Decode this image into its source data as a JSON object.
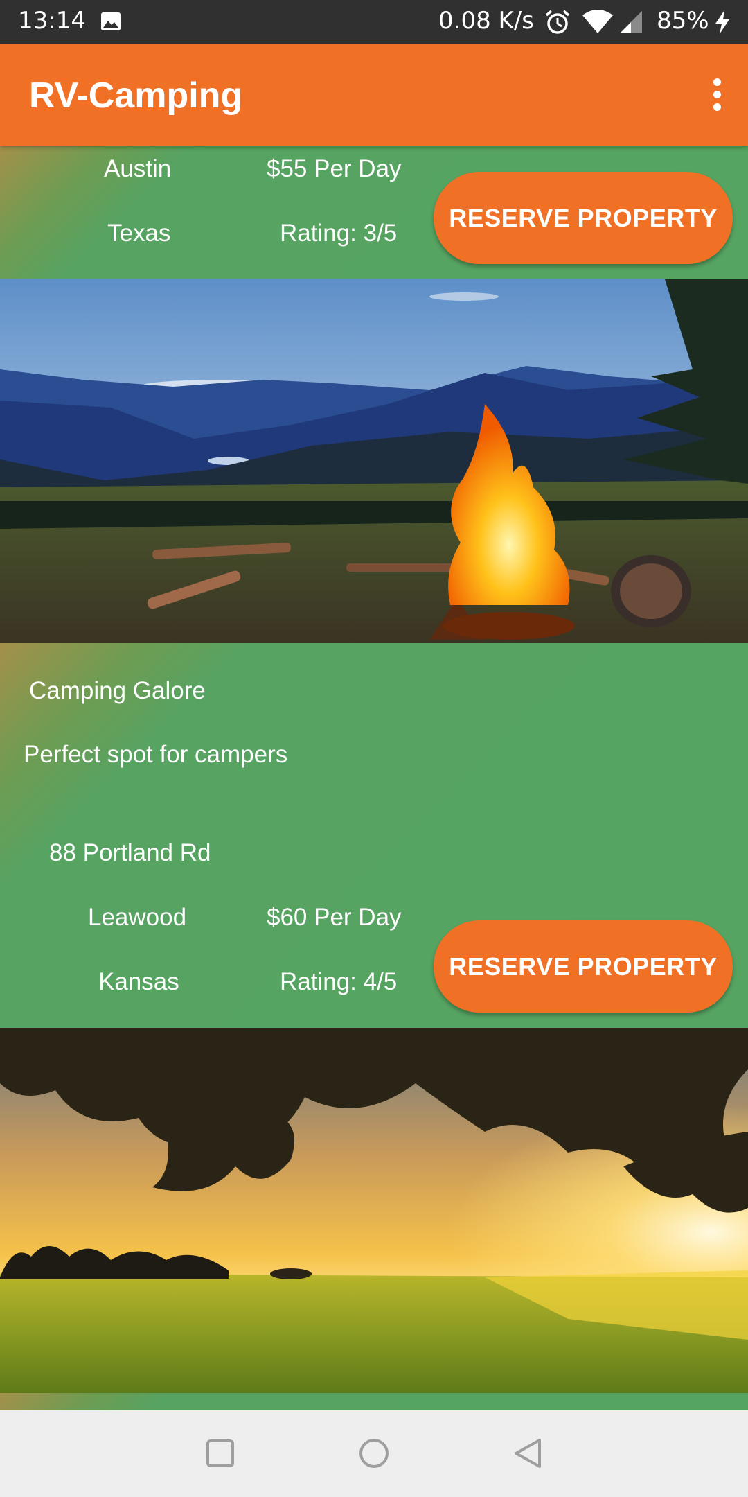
{
  "status_bar": {
    "time": "13:14",
    "net_speed": "0.08 K/s",
    "battery": "85%",
    "icons": [
      "image-icon",
      "alarm-icon",
      "wifi-icon",
      "signal-icon",
      "charging-icon"
    ]
  },
  "app_bar": {
    "title": "RV-Camping",
    "menu_icon": "more-vert-icon"
  },
  "listings": [
    {
      "city": "Austin",
      "state": "Texas",
      "price": "$55 Per Day",
      "rating": "Rating: 3/5",
      "button_label": "RESERVE PROPERTY"
    },
    {
      "name": "Camping Galore",
      "description": "Perfect spot for campers",
      "address": "88 Portland Rd",
      "city": "Leawood",
      "state": "Kansas",
      "price": "$60 Per Day",
      "rating": "Rating: 4/5",
      "button_label": "RESERVE PROPERTY"
    }
  ],
  "photos": [
    "campfire-mountains-photo",
    "sunset-field-photo"
  ],
  "nav_bar": {
    "icons": [
      "recents-icon",
      "home-icon",
      "back-icon"
    ]
  },
  "colors": {
    "accent": "#f07025",
    "card_green": "#56a462",
    "status_bar": "#303030",
    "nav_bar": "#eeeeee"
  }
}
